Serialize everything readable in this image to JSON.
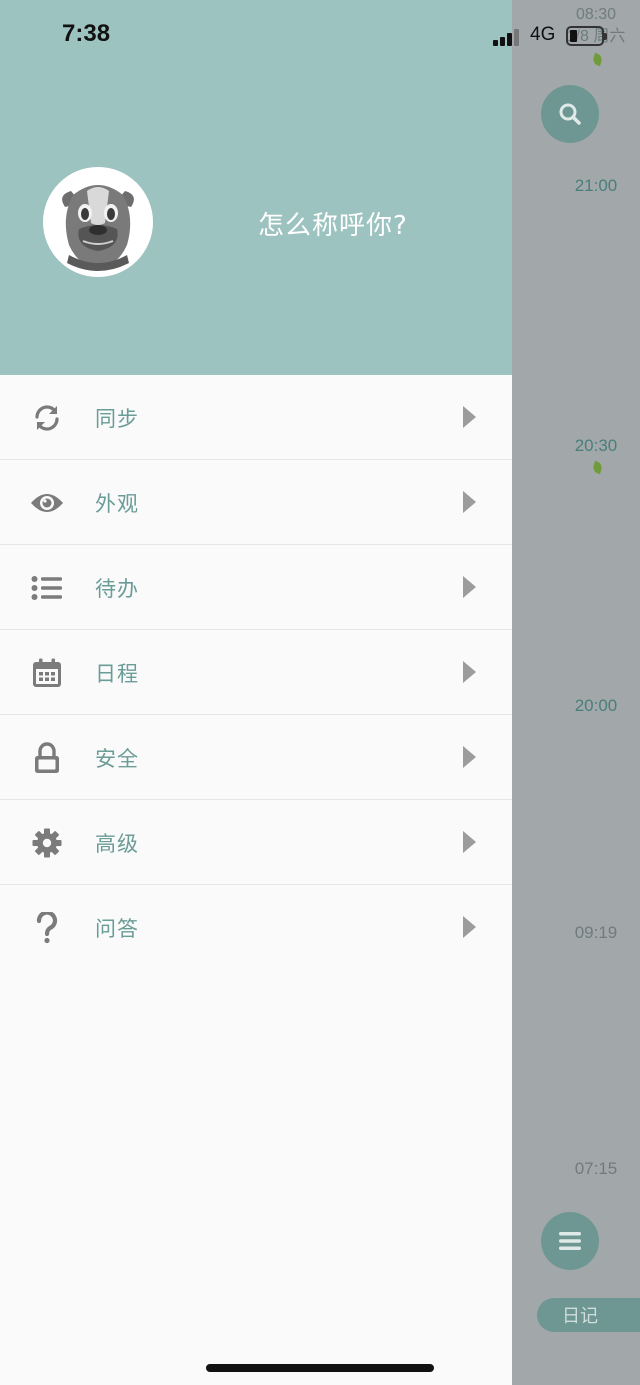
{
  "status_bar": {
    "time": "7:38",
    "network": "4G"
  },
  "drawer": {
    "user_name_prompt": "怎么称呼你?",
    "avatar_icon": "pug-avatar",
    "menu": [
      {
        "label": "同步",
        "icon": "sync-icon"
      },
      {
        "label": "外观",
        "icon": "eye-icon"
      },
      {
        "label": "待办",
        "icon": "list-icon"
      },
      {
        "label": "日程",
        "icon": "calendar-icon"
      },
      {
        "label": "安全",
        "icon": "lock-icon"
      },
      {
        "label": "高级",
        "icon": "gear-icon"
      },
      {
        "label": "问答",
        "icon": "question-icon"
      }
    ]
  },
  "background": {
    "date_time": "08:30",
    "date_label": "1/8 周六",
    "entries": [
      "21:00",
      "20:30",
      "20:00",
      "09:19",
      "07:15"
    ],
    "bottom_tab_label": "日记"
  },
  "colors": {
    "header_bg": "#9dc3c0",
    "accent_text": "#6a9c98",
    "overlay": "#a2a8a9",
    "leaf": "#6f9b3b"
  }
}
